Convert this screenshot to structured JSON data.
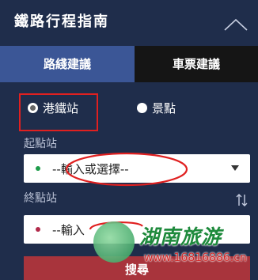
{
  "header": {
    "title": "鐵路行程指南",
    "collapse_icon": "chevron-up-icon"
  },
  "tabs": [
    {
      "label": "路綫建議",
      "active": true
    },
    {
      "label": "車票建議",
      "active": false
    }
  ],
  "search_type": {
    "options": [
      {
        "label": "港鐵站",
        "checked": true
      },
      {
        "label": "景點",
        "checked": false
      }
    ]
  },
  "origin": {
    "label": "起點站",
    "placeholder": "--輸入或選擇--"
  },
  "destination": {
    "label": "終點站",
    "placeholder": "--輸入或選擇--",
    "visible_text": "--輸入"
  },
  "submit": {
    "label": "搜尋"
  },
  "swap_icon": "swap-vertical-icon",
  "watermark": {
    "name": "湖南旅游",
    "url": "www.16816886.cn"
  },
  "colors": {
    "background": "#1f2d4b",
    "active_tab": "#3b5696",
    "inactive_tab": "#151515",
    "highlight": "#e02020",
    "submit": "#a8343c"
  }
}
